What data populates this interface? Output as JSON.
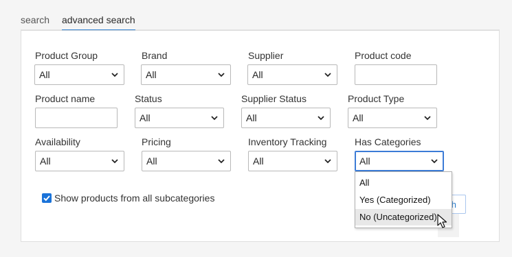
{
  "tabs": [
    {
      "label": "search",
      "active": false
    },
    {
      "label": "advanced search",
      "active": true
    }
  ],
  "filters": {
    "product_group": {
      "label": "Product Group",
      "value": "All"
    },
    "brand": {
      "label": "Brand",
      "value": "All"
    },
    "supplier": {
      "label": "Supplier",
      "value": "All"
    },
    "product_code": {
      "label": "Product code",
      "value": ""
    },
    "product_name": {
      "label": "Product name",
      "value": ""
    },
    "status": {
      "label": "Status",
      "value": "All"
    },
    "supplier_status": {
      "label": "Supplier Status",
      "value": "All"
    },
    "product_type": {
      "label": "Product Type",
      "value": "All"
    },
    "availability": {
      "label": "Availability",
      "value": "All"
    },
    "pricing": {
      "label": "Pricing",
      "value": "All"
    },
    "inventory_tracking": {
      "label": "Inventory Tracking",
      "value": "All"
    },
    "has_categories": {
      "label": "Has Categories",
      "value": "All"
    }
  },
  "subcategories": {
    "label": "Show products from all subcategories",
    "checked": true
  },
  "search_button": {
    "label_fragment": "h"
  },
  "dropdown": {
    "options": [
      "All",
      "Yes (Categorized)",
      "No (Uncategorized)"
    ],
    "hovered_index": 2
  },
  "colors": {
    "accent": "#2d7fcf",
    "checkbox": "#1a73d9",
    "focus": "#3b7bd6"
  }
}
